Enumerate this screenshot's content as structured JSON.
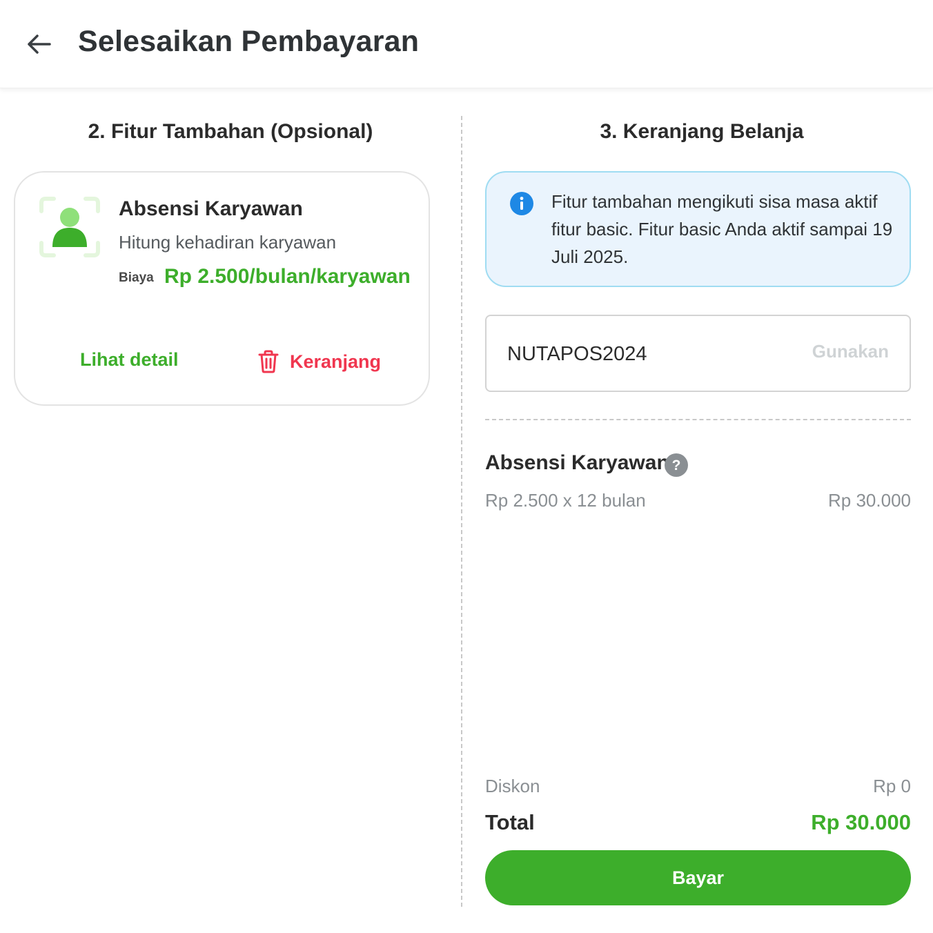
{
  "header": {
    "title": "Selesaikan Pembayaran"
  },
  "left": {
    "section_title": "2.  Fitur Tambahan (Opsional)",
    "card": {
      "name": "Absensi Karyawan",
      "description": "Hitung kehadiran karyawan",
      "price_label": "Biaya",
      "price_value": "Rp 2.500/bulan/karyawan",
      "detail_label": "Lihat detail",
      "cart_label": "Keranjang"
    }
  },
  "right": {
    "section_title": "3.  Keranjang Belanja",
    "info_text": "Fitur tambahan mengikuti sisa masa aktif fitur basic. Fitur basic Anda aktif sampai 19 Juli 2025.",
    "promo": {
      "value": "NUTAPOS2024",
      "apply_label": "Gunakan"
    },
    "cart_item": {
      "name": "Absensi Karyawan",
      "calculation": "Rp 2.500 x 12 bulan",
      "subtotal": "Rp 30.000"
    },
    "summary": {
      "discount_label": "Diskon",
      "discount_value": "Rp 0",
      "total_label": "Total",
      "total_value": "Rp 30.000"
    },
    "pay_label": "Bayar"
  },
  "icons": {
    "back": "arrow-left-icon",
    "feature": "employee-attendance-icon",
    "trash": "trash-icon",
    "info": "info-icon",
    "help": "question-mark-icon"
  },
  "colors": {
    "accent_green": "#3dae2b",
    "danger_red": "#f0364f",
    "info_bg": "#eaf4fd",
    "info_border": "#9fdcf2",
    "info_icon": "#1e88e5"
  }
}
